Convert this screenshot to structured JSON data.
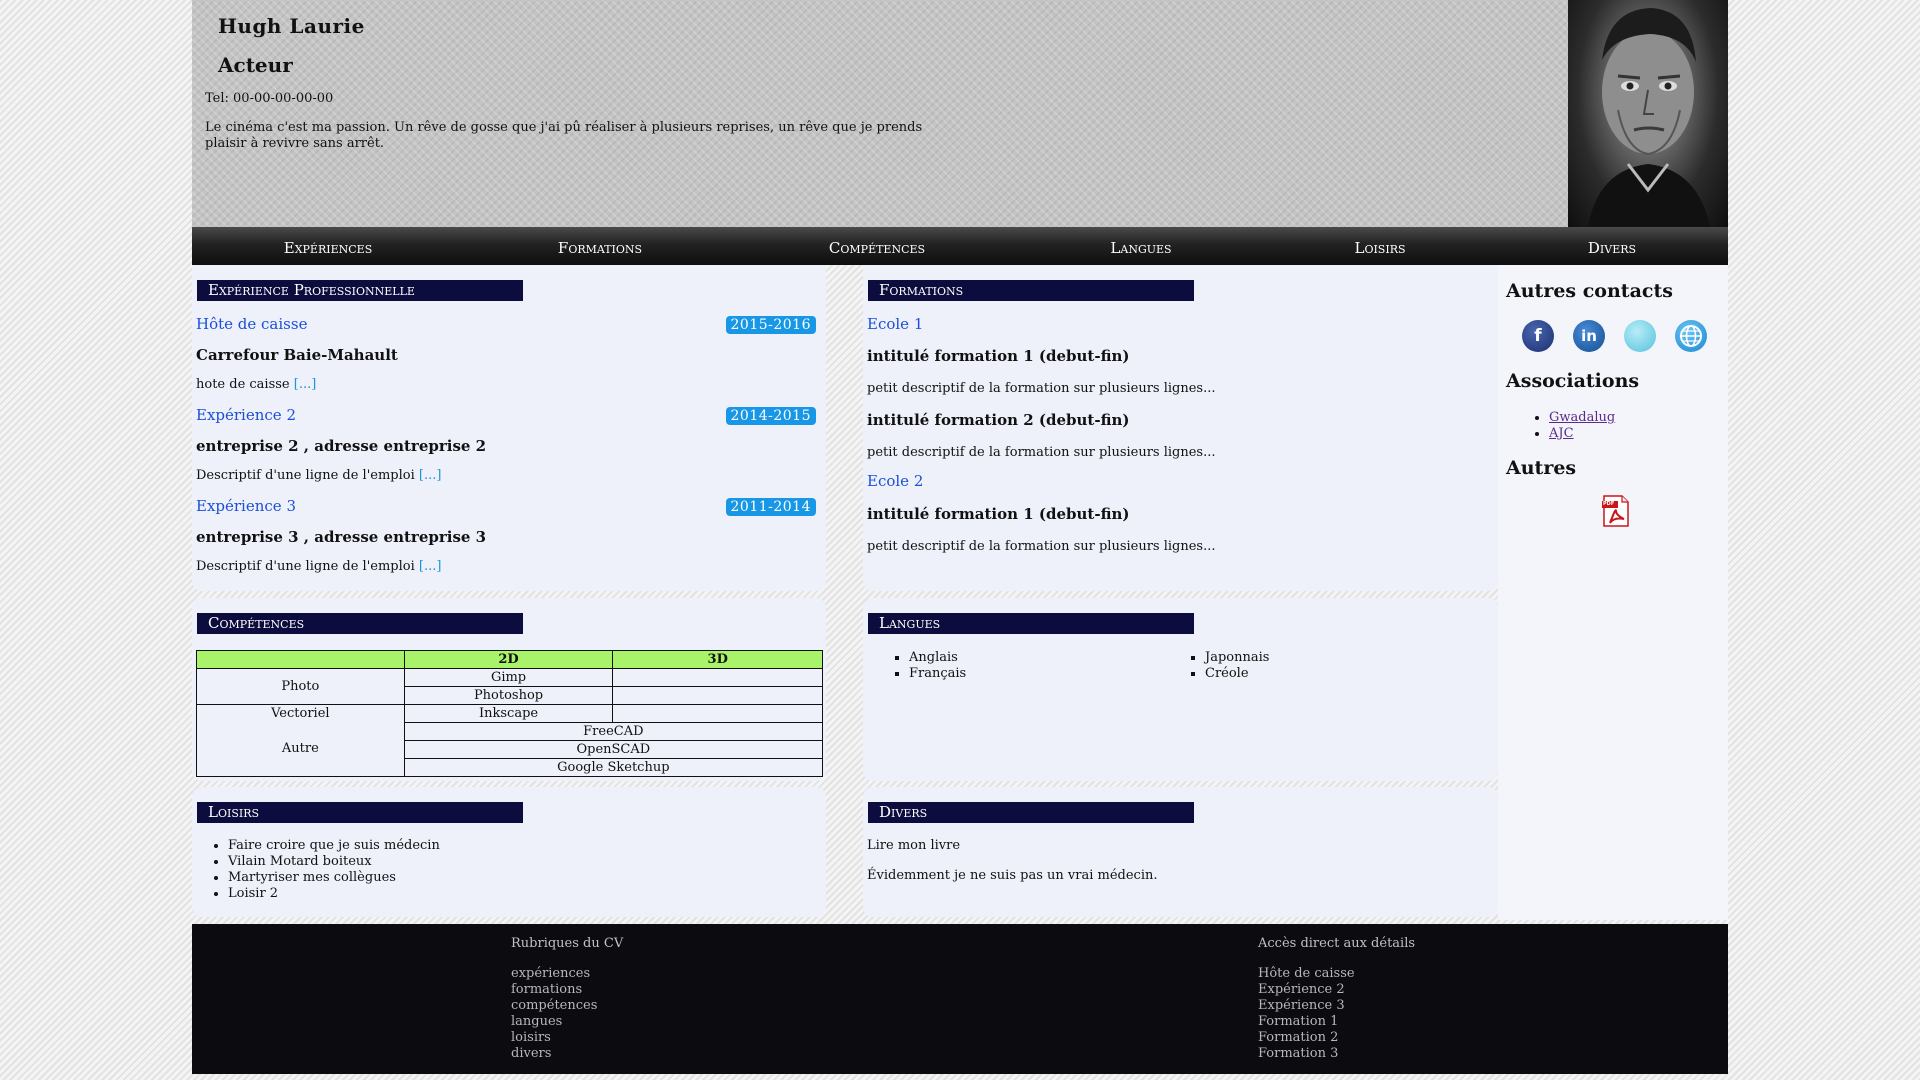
{
  "header": {
    "name": "Hugh Laurie",
    "title": "Acteur",
    "tel": "Tel: 00-00-00-00-00",
    "description": "Le cinéma c'est ma passion. Un rêve de gosse que j'ai pû réaliser à plusieurs reprises, un rêve que je prends plaisir à revivre sans arrêt."
  },
  "nav": [
    "Expériences",
    "Formations",
    "Compétences",
    "Langues",
    "Loisirs",
    "Divers"
  ],
  "experience": {
    "heading": "Expérience Professionnelle",
    "items": [
      {
        "title": "Hôte de caisse",
        "date": "2015-2016",
        "company": "Carrefour Baie-Mahault",
        "desc": "hote de caisse",
        "more": "[...]"
      },
      {
        "title": "Expérience 2",
        "date": "2014-2015",
        "company": "entreprise 2 , adresse entreprise 2",
        "desc": "Descriptif d'une ligne de l'emploi",
        "more": "[...]"
      },
      {
        "title": "Expérience 3",
        "date": "2011-2014",
        "company": "entreprise 3 , adresse entreprise 3",
        "desc": "Descriptif d'une ligne de l'emploi",
        "more": "[...]"
      }
    ]
  },
  "formations": {
    "heading": "Formations",
    "school1": "Ecole 1",
    "f1_title": "intitulé formation 1 (debut-fin)",
    "f1_desc": "petit descriptif de la formation sur plusieurs lignes...",
    "f2_title": "intitulé formation 2 (debut-fin)",
    "f2_desc": "petit descriptif de la formation sur plusieurs lignes...",
    "school2": "Ecole 2",
    "f3_title": "intitulé formation 1 (debut-fin)",
    "f3_desc": "petit descriptif de la formation sur plusieurs lignes..."
  },
  "competences": {
    "heading": "Compétences",
    "col_2d": "2D",
    "col_3d": "3D",
    "photo": "Photo",
    "gimp": "Gimp",
    "photoshop": "Photoshop",
    "vectoriel": "Vectoriel",
    "inkscape": "Inkscape",
    "autre": "Autre",
    "freecad": "FreeCAD",
    "openscad": "OpenSCAD",
    "sketchup": "Google Sketchup"
  },
  "langues": {
    "heading": "Langues",
    "items": [
      "Anglais",
      "Français",
      "Japonnais",
      "Créole"
    ]
  },
  "loisirs": {
    "heading": "Loisirs",
    "items": [
      "Faire croire que je suis médecin",
      "Vilain Motard boiteux",
      "Martyriser mes collègues",
      "Loisir 2"
    ]
  },
  "divers": {
    "heading": "Divers",
    "line1": "Lire mon livre",
    "line2": "Évidemment je ne suis pas un vrai médecin."
  },
  "right": {
    "contacts_heading": "Autres contacts",
    "assoc_heading": "Associations",
    "assoc": [
      "Gwadalug",
      "AJC"
    ],
    "autres_heading": "Autres",
    "pdf_label": "PDF"
  },
  "footer": {
    "col1_heading": "Rubriques du CV",
    "col1": [
      "expériences",
      "formations",
      "compétences",
      "langues",
      "loisirs",
      "divers"
    ],
    "col2_heading": "Accès direct aux détails",
    "col2": [
      "Hôte de caisse",
      "Expérience 2",
      "Expérience 3",
      "Formation 1",
      "Formation 2",
      "Formation 3"
    ]
  },
  "colors": {
    "nav_bg": "#1a1a1a",
    "section_title_bg": "#0c0c3e",
    "link_blue": "#1a4fd6",
    "date_badge": "#1897e6",
    "table_header": "#a8f36a",
    "footer_bg": "#0b0b10"
  }
}
